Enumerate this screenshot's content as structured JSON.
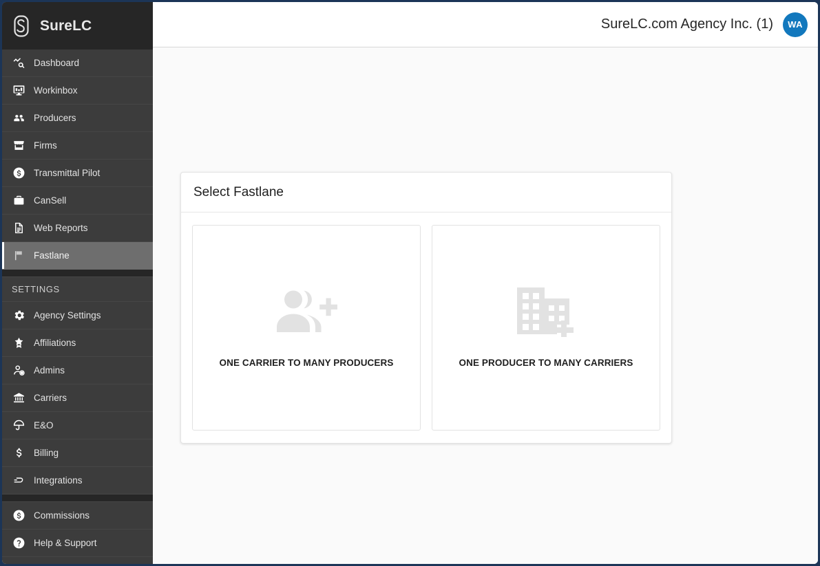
{
  "frame": {
    "border_color": "#1c3557"
  },
  "sidebar": {
    "brand": {
      "name": "SureLC",
      "logo_icon": "surelc-s-logo-icon"
    },
    "primary_items": [
      {
        "label": "Dashboard",
        "icon": "analytics-icon",
        "active": false
      },
      {
        "label": "Workinbox",
        "icon": "desktop-monitor-icon",
        "active": false
      },
      {
        "label": "Producers",
        "icon": "people-group-icon",
        "active": false
      },
      {
        "label": "Firms",
        "icon": "storefront-icon",
        "active": false
      },
      {
        "label": "Transmittal Pilot",
        "icon": "dollar-circle-icon",
        "active": false
      },
      {
        "label": "CanSell",
        "icon": "briefcase-icon",
        "active": false
      },
      {
        "label": "Web Reports",
        "icon": "document-icon",
        "active": false
      },
      {
        "label": "Fastlane",
        "icon": "flag-icon",
        "active": true
      }
    ],
    "settings_label": "SETTINGS",
    "settings_items": [
      {
        "label": "Agency Settings",
        "icon": "gear-icon"
      },
      {
        "label": "Affiliations",
        "icon": "star-badge-icon"
      },
      {
        "label": "Admins",
        "icon": "person-settings-icon"
      },
      {
        "label": "Carriers",
        "icon": "bank-icon"
      },
      {
        "label": "E&O",
        "icon": "umbrella-icon"
      },
      {
        "label": "Billing",
        "icon": "dollar-sign-icon"
      },
      {
        "label": "Integrations",
        "icon": "plug-connector-icon"
      }
    ],
    "footer_items": [
      {
        "label": "Commissions",
        "icon": "dollar-circle-icon"
      },
      {
        "label": "Help & Support",
        "icon": "question-circle-icon"
      }
    ],
    "colors": {
      "background": "#3c3c3c",
      "brand_background": "#262626",
      "active_background": "#6e6e6e",
      "active_indicator": "#ffffff"
    }
  },
  "topbar": {
    "agency_name": "SureLC.com Agency Inc. (1)",
    "avatar_initials": "WA",
    "avatar_color": "#1278bd"
  },
  "panel": {
    "title": "Select Fastlane",
    "options": [
      {
        "label": "ONE CARRIER TO MANY PRODUCERS",
        "icon": "group-add-icon"
      },
      {
        "label": "ONE PRODUCER TO MANY CARRIERS",
        "icon": "domain-add-icon"
      }
    ]
  }
}
